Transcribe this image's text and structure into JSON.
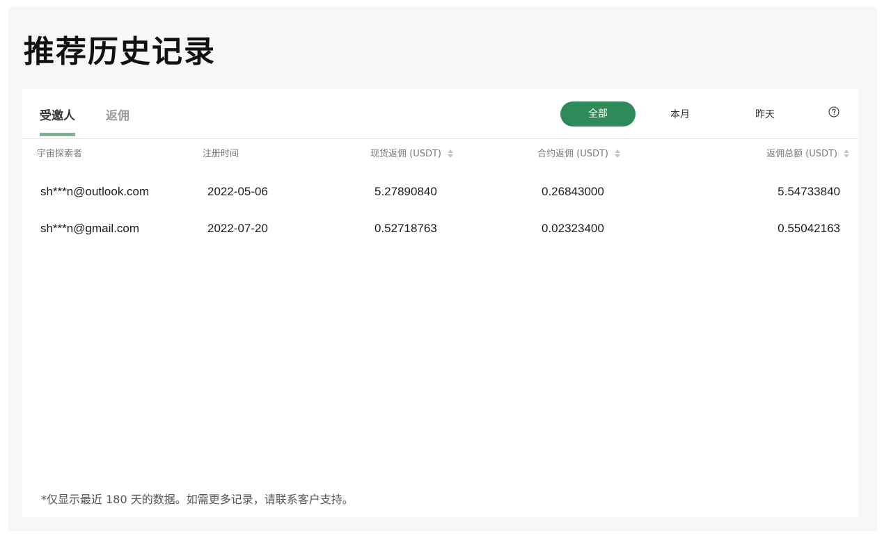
{
  "page": {
    "title": "推荐历史记录"
  },
  "tabs": [
    {
      "label": "受邀人",
      "active": true
    },
    {
      "label": "返佣",
      "active": false
    }
  ],
  "filters": {
    "options": [
      "全部",
      "本月",
      "昨天"
    ],
    "selected": "全部",
    "help_icon": "question-circle-icon"
  },
  "table": {
    "columns": [
      "宇宙探索者",
      "注册时间",
      "现货返佣 (USDT)",
      "合约返佣 (USDT)",
      "返佣总额 (USDT)"
    ],
    "rows": [
      {
        "email": "sh***n@outlook.com",
        "date": "2022-05-06",
        "spot": "5.27890840",
        "contract": "0.26843000",
        "total": "5.54733840"
      },
      {
        "email": "sh***n@gmail.com",
        "date": "2022-07-20",
        "spot": "0.52718763",
        "contract": "0.02323400",
        "total": "0.55042163"
      }
    ]
  },
  "footnote": "*仅显示最近 180 天的数据。如需更多记录，请联系客户支持。",
  "colors": {
    "accent": "#2f8a5a",
    "tab_underline": "#7bb394",
    "page_bg": "#f7f7f7"
  }
}
